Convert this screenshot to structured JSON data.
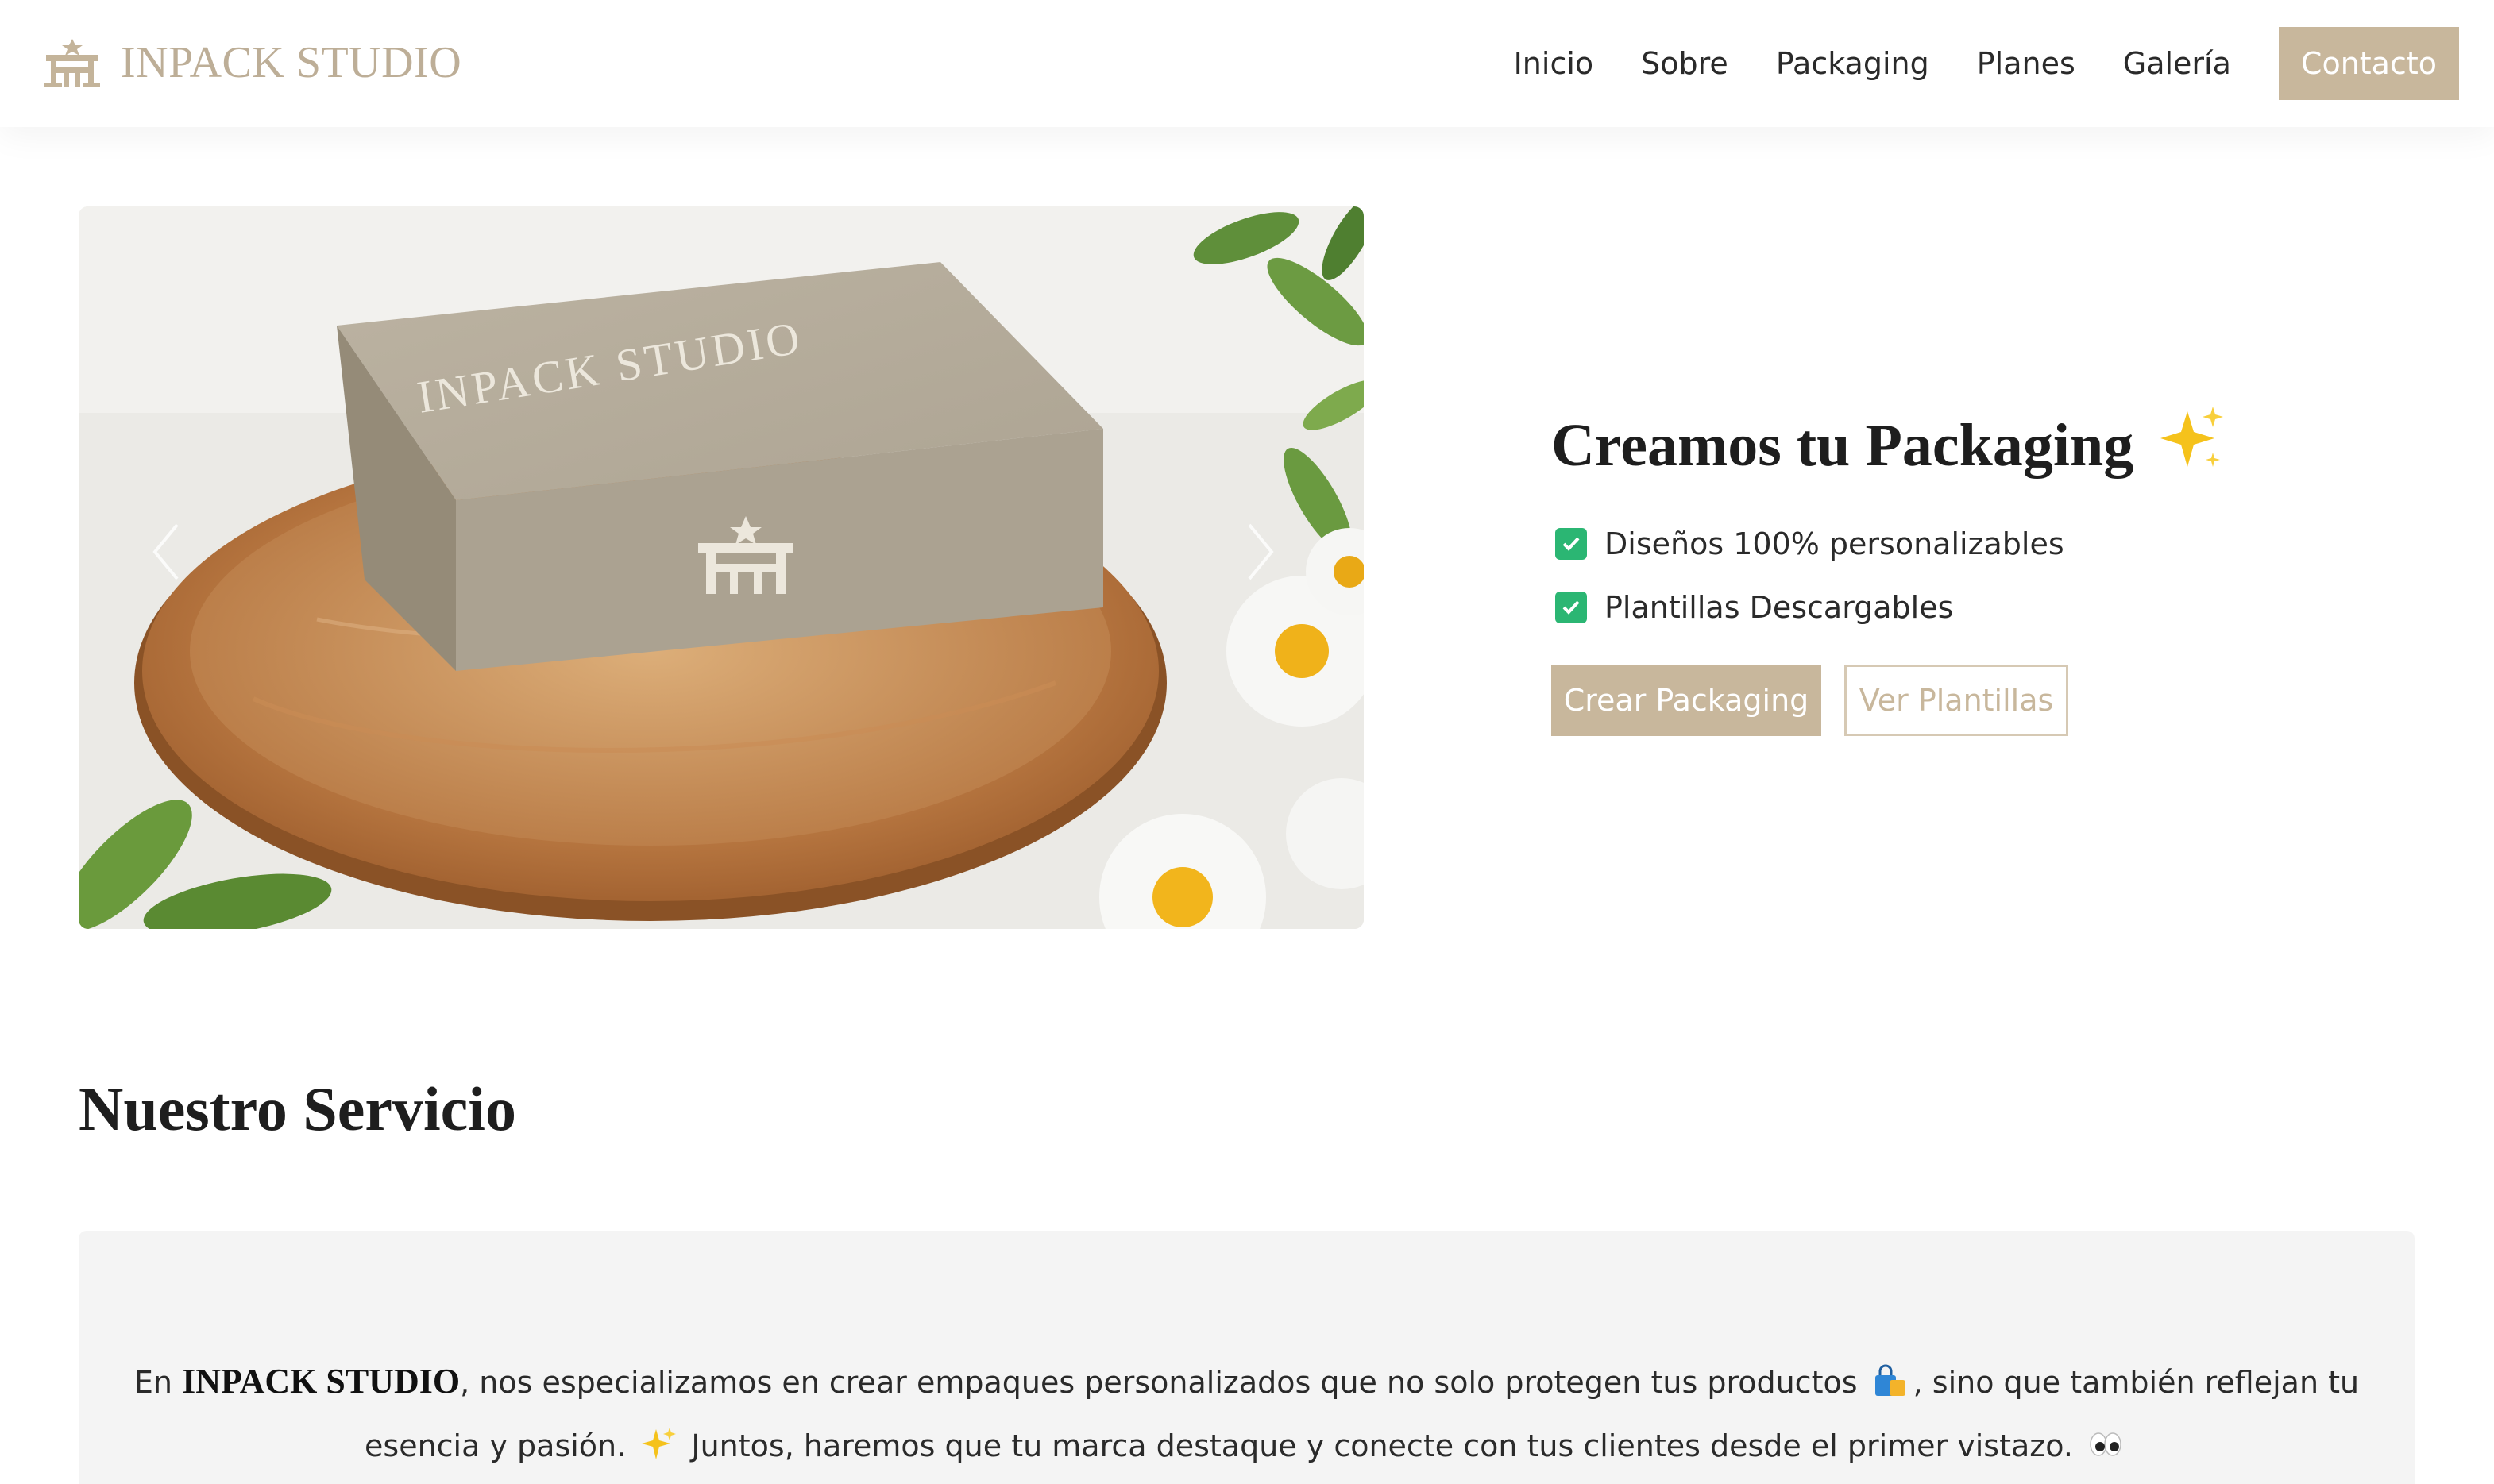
{
  "header": {
    "brand_name": "INPACK STUDIO",
    "logo_icon": "inpack-logo-icon",
    "nav": [
      {
        "label": "Inicio"
      },
      {
        "label": "Sobre"
      },
      {
        "label": "Packaging"
      },
      {
        "label": "Planes"
      },
      {
        "label": "Galería"
      }
    ],
    "contact_label": "Contacto"
  },
  "hero": {
    "image": {
      "box_text": "INPACK STUDIO",
      "description_icons": [
        "prev-arrow-icon",
        "next-arrow-icon"
      ]
    },
    "title": "Creamos tu Packaging",
    "title_icon": "sparkles-icon",
    "features": [
      {
        "label": "Diseños 100% personalizables",
        "icon": "check-icon"
      },
      {
        "label": "Plantillas Descargables",
        "icon": "check-icon"
      }
    ],
    "primary_button": "Crear Packaging",
    "secondary_button": "Ver Plantillas"
  },
  "service": {
    "title": "Nuestro Servicio",
    "text_prefix": "En ",
    "brand": "INPACK STUDIO",
    "text_part1": ", nos especializamos en crear empaques personalizados que no solo protegen tus productos ",
    "text_part2": ", sino que también reflejan tu",
    "text_part3": "esencia y pasión. ",
    "text_part4": " Juntos, haremos que tu marca destaque y conecte con tus clientes desde el primer vistazo. ",
    "emoji_icons": [
      "shopping-bags-icon",
      "sparkles-icon",
      "eyes-icon"
    ]
  },
  "colors": {
    "accent": "#c8b79c",
    "brand_text": "#bdae97",
    "check_green": "#2bb673",
    "section_bg": "#f4f4f4"
  }
}
